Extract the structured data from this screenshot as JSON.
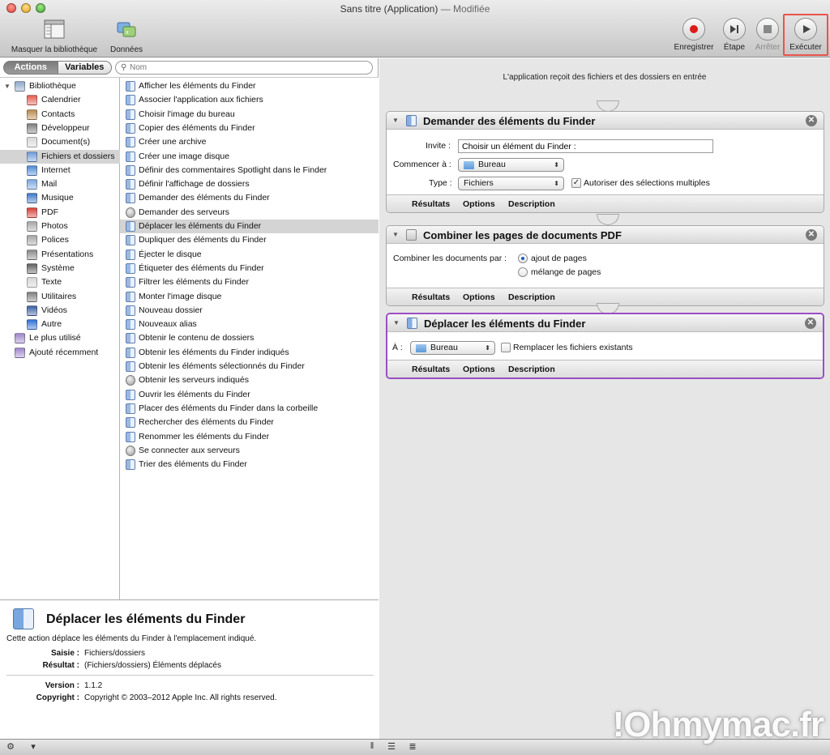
{
  "window": {
    "title": "Sans titre (Application)",
    "title_suffix": "— Modifiée"
  },
  "toolbar": {
    "hide_library": "Masquer la bibliothèque",
    "data": "Données",
    "record": "Enregistrer",
    "step": "Étape",
    "stop": "Arrêter",
    "run": "Exécuter"
  },
  "library": {
    "tab_actions": "Actions",
    "tab_variables": "Variables",
    "search_placeholder": "Nom",
    "categories": [
      {
        "label": "Bibliothèque",
        "icon": "library-icon",
        "color": "#8fa7c9"
      },
      {
        "label": "Calendrier",
        "icon": "calendar-icon",
        "color": "#e55c4f"
      },
      {
        "label": "Contacts",
        "icon": "contacts-icon",
        "color": "#b98a50"
      },
      {
        "label": "Développeur",
        "icon": "developer-icon",
        "color": "#7d7d7d"
      },
      {
        "label": "Document(s)",
        "icon": "document-icon",
        "color": "#d9d9d9"
      },
      {
        "label": "Fichiers et dossiers",
        "icon": "finder-icon",
        "color": "#6e9ad8"
      },
      {
        "label": "Internet",
        "icon": "internet-icon",
        "color": "#4f8ad3"
      },
      {
        "label": "Mail",
        "icon": "mail-icon",
        "color": "#7aa6df"
      },
      {
        "label": "Musique",
        "icon": "music-icon",
        "color": "#3f79c5"
      },
      {
        "label": "PDF",
        "icon": "pdf-icon",
        "color": "#d64038"
      },
      {
        "label": "Photos",
        "icon": "photos-icon",
        "color": "#a7a7a7"
      },
      {
        "label": "Polices",
        "icon": "fonts-icon",
        "color": "#a5a5a5"
      },
      {
        "label": "Présentations",
        "icon": "presentations-icon",
        "color": "#8a8a8a"
      },
      {
        "label": "Système",
        "icon": "system-icon",
        "color": "#5f5f5f"
      },
      {
        "label": "Texte",
        "icon": "text-icon",
        "color": "#d6d6d6"
      },
      {
        "label": "Utilitaires",
        "icon": "utilities-icon",
        "color": "#808080"
      },
      {
        "label": "Vidéos",
        "icon": "videos-icon",
        "color": "#3b5fa3"
      },
      {
        "label": "Autre",
        "icon": "other-icon",
        "color": "#2e6fd6"
      },
      {
        "label": "Le plus utilisé",
        "icon": "smart-folder-icon",
        "color": "#9e86c9"
      },
      {
        "label": "Ajouté récemment",
        "icon": "smart-folder-icon",
        "color": "#9e86c9"
      }
    ],
    "actions": [
      {
        "label": "Afficher les éléments du Finder"
      },
      {
        "label": "Associer l'application aux fichiers"
      },
      {
        "label": "Choisir l'image du bureau"
      },
      {
        "label": "Copier des éléments du Finder"
      },
      {
        "label": "Créer une archive"
      },
      {
        "label": "Créer une image disque"
      },
      {
        "label": "Définir des commentaires Spotlight dans le Finder"
      },
      {
        "label": "Définir l'affichage de dossiers"
      },
      {
        "label": "Demander des éléments du Finder"
      },
      {
        "label": "Demander des serveurs",
        "icon": "globe"
      },
      {
        "label": "Déplacer les éléments du Finder"
      },
      {
        "label": "Dupliquer des éléments du Finder"
      },
      {
        "label": "Éjecter le disque"
      },
      {
        "label": "Étiqueter des éléments du Finder"
      },
      {
        "label": "Filtrer les éléments du Finder"
      },
      {
        "label": "Monter l'image disque"
      },
      {
        "label": "Nouveau dossier"
      },
      {
        "label": "Nouveaux alias"
      },
      {
        "label": "Obtenir le contenu de dossiers"
      },
      {
        "label": "Obtenir les éléments du Finder indiqués"
      },
      {
        "label": "Obtenir les éléments sélectionnés du Finder"
      },
      {
        "label": "Obtenir les serveurs indiqués",
        "icon": "globe"
      },
      {
        "label": "Ouvrir les éléments du Finder"
      },
      {
        "label": "Placer des éléments du Finder dans la corbeille"
      },
      {
        "label": "Rechercher des éléments du Finder"
      },
      {
        "label": "Renommer les éléments du Finder"
      },
      {
        "label": "Se connecter aux serveurs",
        "icon": "globe"
      },
      {
        "label": "Trier des éléments du Finder"
      }
    ],
    "description": {
      "title": "Déplacer les éléments du Finder",
      "text": "Cette action déplace les éléments du Finder à l'emplacement indiqué.",
      "input_label": "Saisie :",
      "input_value": "Fichiers/dossiers",
      "result_label": "Résultat :",
      "result_value": "(Fichiers/dossiers) Éléments déplacés",
      "version_label": "Version :",
      "version_value": "1.1.2",
      "copyright_label": "Copyright :",
      "copyright_value": "Copyright © 2003–2012 Apple Inc.  All rights reserved."
    }
  },
  "workflow": {
    "header": "L'application reçoit des fichiers et des dossiers en entrée",
    "footer_results": "Résultats",
    "footer_options": "Options",
    "footer_description": "Description",
    "action1": {
      "title": "Demander des éléments du Finder",
      "prompt_label": "Invite :",
      "prompt_value": "Choisir un élément du Finder :",
      "start_label": "Commencer à :",
      "start_value": "Bureau",
      "type_label": "Type :",
      "type_value": "Fichiers",
      "multi_label": "Autoriser des sélections multiples",
      "multi_check": "✓"
    },
    "action2": {
      "title": "Combiner les pages de documents PDF",
      "combine_label": "Combiner les documents par :",
      "option1": "ajout de pages",
      "option2": "mélange de pages"
    },
    "action3": {
      "title": "Déplacer les éléments du Finder",
      "to_label": "À :",
      "to_value": "Bureau",
      "replace_label": "Remplacer les fichiers existants"
    }
  },
  "watermark": "!Ohmymac.fr",
  "colors": {
    "accent": "#9b4fc3",
    "highlight": "#e8554b",
    "record": "#e01b1b"
  }
}
